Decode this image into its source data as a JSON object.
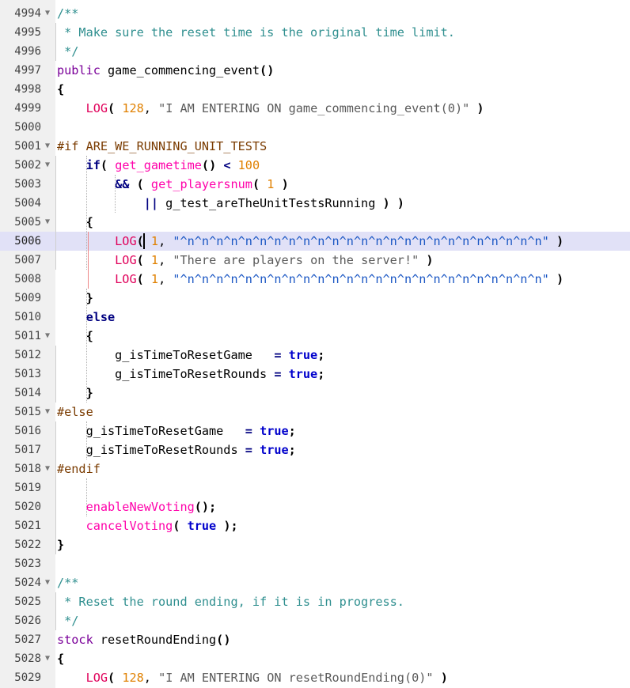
{
  "editor": {
    "current_line": 5006,
    "lines": [
      {
        "num": "4994",
        "fold": "▼",
        "tokens": [
          {
            "t": "/**",
            "c": "t-comment"
          }
        ]
      },
      {
        "num": "4995",
        "fold": "",
        "tokens": [
          {
            "t": " * Make sure the reset time is the original time limit.",
            "c": "t-comment"
          }
        ]
      },
      {
        "num": "4996",
        "fold": "",
        "tokens": [
          {
            "t": " */",
            "c": "t-comment"
          }
        ]
      },
      {
        "num": "4997",
        "fold": "",
        "tokens": [
          {
            "t": "public",
            "c": "t-kw"
          },
          {
            "t": " game_commencing_event",
            "c": "t-ident"
          },
          {
            "t": "()",
            "c": "t-paren"
          }
        ]
      },
      {
        "num": "4998",
        "fold": "",
        "tokens": [
          {
            "t": "{",
            "c": "t-paren"
          }
        ]
      },
      {
        "num": "4999",
        "fold": "",
        "tokens": [
          {
            "t": "    ",
            "c": "t-ident"
          },
          {
            "t": "LOG",
            "c": "t-log"
          },
          {
            "t": "(",
            "c": "t-paren"
          },
          {
            "t": " ",
            "c": "t-ident"
          },
          {
            "t": "128",
            "c": "t-num"
          },
          {
            "t": ", ",
            "c": "t-punct"
          },
          {
            "t": "\"I AM ENTERING ON game_commencing_event(0)\"",
            "c": "t-str"
          },
          {
            "t": " ",
            "c": "t-ident"
          },
          {
            "t": ")",
            "c": "t-paren"
          }
        ]
      },
      {
        "num": "5000",
        "fold": "",
        "tokens": []
      },
      {
        "num": "5001",
        "fold": "▼",
        "tokens": [
          {
            "t": "#if ARE_WE_RUNNING_UNIT_TESTS",
            "c": "t-pre"
          }
        ]
      },
      {
        "num": "5002",
        "fold": "▼",
        "tokens": [
          {
            "t": "    ",
            "c": "t-ident"
          },
          {
            "t": "if",
            "c": "t-op"
          },
          {
            "t": "(",
            "c": "t-paren"
          },
          {
            "t": " ",
            "c": "t-ident"
          },
          {
            "t": "get_gametime",
            "c": "t-func"
          },
          {
            "t": "()",
            "c": "t-paren"
          },
          {
            "t": " < ",
            "c": "t-op"
          },
          {
            "t": "100",
            "c": "t-num"
          }
        ]
      },
      {
        "num": "5003",
        "fold": "",
        "tokens": [
          {
            "t": "        ",
            "c": "t-ident"
          },
          {
            "t": "&&",
            "c": "t-op"
          },
          {
            "t": " ",
            "c": "t-ident"
          },
          {
            "t": "(",
            "c": "t-paren"
          },
          {
            "t": " ",
            "c": "t-ident"
          },
          {
            "t": "get_playersnum",
            "c": "t-func"
          },
          {
            "t": "(",
            "c": "t-paren"
          },
          {
            "t": " ",
            "c": "t-ident"
          },
          {
            "t": "1",
            "c": "t-num"
          },
          {
            "t": " ",
            "c": "t-ident"
          },
          {
            "t": ")",
            "c": "t-paren"
          }
        ]
      },
      {
        "num": "5004",
        "fold": "",
        "tokens": [
          {
            "t": "            ",
            "c": "t-ident"
          },
          {
            "t": "||",
            "c": "t-op"
          },
          {
            "t": " g_test_areTheUnitTestsRunning ",
            "c": "t-ident"
          },
          {
            "t": ")",
            "c": "t-paren"
          },
          {
            "t": " ",
            "c": "t-ident"
          },
          {
            "t": ")",
            "c": "t-paren"
          }
        ]
      },
      {
        "num": "5005",
        "fold": "▼",
        "tokens": [
          {
            "t": "    ",
            "c": "t-ident"
          },
          {
            "t": "{",
            "c": "t-paren"
          }
        ]
      },
      {
        "num": "5006",
        "fold": "",
        "tokens": [
          {
            "t": "        ",
            "c": "t-ident"
          },
          {
            "t": "LOG",
            "c": "t-log"
          },
          {
            "t": "(",
            "c": "t-paren"
          },
          {
            "t": " ",
            "c": "t-ident"
          },
          {
            "t": "1",
            "c": "t-num"
          },
          {
            "t": ", ",
            "c": "t-punct"
          },
          {
            "t": "\"^n^n^n^n^n^n^n^n^n^n^n^n^n^n^n^n^n^n^n^n^n^n^n^n^n\"",
            "c": "t-str-blue"
          },
          {
            "t": " ",
            "c": "t-ident"
          },
          {
            "t": ")",
            "c": "t-paren"
          }
        ]
      },
      {
        "num": "5007",
        "fold": "",
        "tokens": [
          {
            "t": "        ",
            "c": "t-ident"
          },
          {
            "t": "LOG",
            "c": "t-log"
          },
          {
            "t": "(",
            "c": "t-paren"
          },
          {
            "t": " ",
            "c": "t-ident"
          },
          {
            "t": "1",
            "c": "t-num"
          },
          {
            "t": ", ",
            "c": "t-punct"
          },
          {
            "t": "\"There are players on the server!\"",
            "c": "t-str"
          },
          {
            "t": " ",
            "c": "t-ident"
          },
          {
            "t": ")",
            "c": "t-paren"
          }
        ]
      },
      {
        "num": "5008",
        "fold": "",
        "tokens": [
          {
            "t": "        ",
            "c": "t-ident"
          },
          {
            "t": "LOG",
            "c": "t-log"
          },
          {
            "t": "(",
            "c": "t-paren"
          },
          {
            "t": " ",
            "c": "t-ident"
          },
          {
            "t": "1",
            "c": "t-num"
          },
          {
            "t": ", ",
            "c": "t-punct"
          },
          {
            "t": "\"^n^n^n^n^n^n^n^n^n^n^n^n^n^n^n^n^n^n^n^n^n^n^n^n^n\"",
            "c": "t-str-blue"
          },
          {
            "t": " ",
            "c": "t-ident"
          },
          {
            "t": ")",
            "c": "t-paren"
          }
        ]
      },
      {
        "num": "5009",
        "fold": "",
        "tokens": [
          {
            "t": "    ",
            "c": "t-ident"
          },
          {
            "t": "}",
            "c": "t-paren"
          }
        ]
      },
      {
        "num": "5010",
        "fold": "",
        "tokens": [
          {
            "t": "    ",
            "c": "t-ident"
          },
          {
            "t": "else",
            "c": "t-op"
          }
        ]
      },
      {
        "num": "5011",
        "fold": "▼",
        "tokens": [
          {
            "t": "    ",
            "c": "t-ident"
          },
          {
            "t": "{",
            "c": "t-paren"
          }
        ]
      },
      {
        "num": "5012",
        "fold": "",
        "tokens": [
          {
            "t": "        g_isTimeToResetGame   ",
            "c": "t-ident"
          },
          {
            "t": "=",
            "c": "t-op"
          },
          {
            "t": " ",
            "c": "t-ident"
          },
          {
            "t": "true",
            "c": "t-bool"
          },
          {
            "t": ";",
            "c": "t-paren"
          }
        ]
      },
      {
        "num": "5013",
        "fold": "",
        "tokens": [
          {
            "t": "        g_isTimeToResetRounds ",
            "c": "t-ident"
          },
          {
            "t": "=",
            "c": "t-op"
          },
          {
            "t": " ",
            "c": "t-ident"
          },
          {
            "t": "true",
            "c": "t-bool"
          },
          {
            "t": ";",
            "c": "t-paren"
          }
        ]
      },
      {
        "num": "5014",
        "fold": "",
        "tokens": [
          {
            "t": "    ",
            "c": "t-ident"
          },
          {
            "t": "}",
            "c": "t-paren"
          }
        ]
      },
      {
        "num": "5015",
        "fold": "▼",
        "tokens": [
          {
            "t": "#else",
            "c": "t-pre"
          }
        ]
      },
      {
        "num": "5016",
        "fold": "",
        "tokens": [
          {
            "t": "    g_isTimeToResetGame   ",
            "c": "t-ident"
          },
          {
            "t": "=",
            "c": "t-op"
          },
          {
            "t": " ",
            "c": "t-ident"
          },
          {
            "t": "true",
            "c": "t-bool"
          },
          {
            "t": ";",
            "c": "t-paren"
          }
        ]
      },
      {
        "num": "5017",
        "fold": "",
        "tokens": [
          {
            "t": "    g_isTimeToResetRounds ",
            "c": "t-ident"
          },
          {
            "t": "=",
            "c": "t-op"
          },
          {
            "t": " ",
            "c": "t-ident"
          },
          {
            "t": "true",
            "c": "t-bool"
          },
          {
            "t": ";",
            "c": "t-paren"
          }
        ]
      },
      {
        "num": "5018",
        "fold": "▼",
        "tokens": [
          {
            "t": "#endif",
            "c": "t-pre"
          }
        ]
      },
      {
        "num": "5019",
        "fold": "",
        "tokens": []
      },
      {
        "num": "5020",
        "fold": "",
        "tokens": [
          {
            "t": "    ",
            "c": "t-ident"
          },
          {
            "t": "enableNewVoting",
            "c": "t-func"
          },
          {
            "t": "();",
            "c": "t-paren"
          }
        ]
      },
      {
        "num": "5021",
        "fold": "",
        "tokens": [
          {
            "t": "    ",
            "c": "t-ident"
          },
          {
            "t": "cancelVoting",
            "c": "t-func"
          },
          {
            "t": "(",
            "c": "t-paren"
          },
          {
            "t": " ",
            "c": "t-ident"
          },
          {
            "t": "true",
            "c": "t-bool"
          },
          {
            "t": " ",
            "c": "t-ident"
          },
          {
            "t": ");",
            "c": "t-paren"
          }
        ]
      },
      {
        "num": "5022",
        "fold": "",
        "tokens": [
          {
            "t": "}",
            "c": "t-paren"
          }
        ]
      },
      {
        "num": "5023",
        "fold": "",
        "tokens": []
      },
      {
        "num": "5024",
        "fold": "▼",
        "tokens": [
          {
            "t": "/**",
            "c": "t-comment"
          }
        ]
      },
      {
        "num": "5025",
        "fold": "",
        "tokens": [
          {
            "t": " * Reset the round ending, if it is in progress.",
            "c": "t-comment"
          }
        ]
      },
      {
        "num": "5026",
        "fold": "",
        "tokens": [
          {
            "t": " */",
            "c": "t-comment"
          }
        ]
      },
      {
        "num": "5027",
        "fold": "",
        "tokens": [
          {
            "t": "stock",
            "c": "t-kw"
          },
          {
            "t": " resetRoundEnding",
            "c": "t-ident"
          },
          {
            "t": "()",
            "c": "t-paren"
          }
        ]
      },
      {
        "num": "5028",
        "fold": "▼",
        "tokens": [
          {
            "t": "{",
            "c": "t-paren"
          }
        ]
      },
      {
        "num": "5029",
        "fold": "",
        "tokens": [
          {
            "t": "    ",
            "c": "t-ident"
          },
          {
            "t": "LOG",
            "c": "t-log"
          },
          {
            "t": "(",
            "c": "t-paren"
          },
          {
            "t": " ",
            "c": "t-ident"
          },
          {
            "t": "128",
            "c": "t-num"
          },
          {
            "t": ", ",
            "c": "t-punct"
          },
          {
            "t": "\"I AM ENTERING ON resetRoundEnding(0)\"",
            "c": "t-str"
          },
          {
            "t": " ",
            "c": "t-ident"
          },
          {
            "t": ")",
            "c": "t-paren"
          }
        ]
      }
    ]
  },
  "colors": {
    "gutter_bg": "#f0f0f0",
    "current_line_bg": "#e1e1f7",
    "comment": "#2f8f8f",
    "keyword": "#7a0099",
    "function": "#ff00aa",
    "number": "#e08000",
    "string": "#5a5a5a",
    "string_highlight": "#1b57c4",
    "preprocessor": "#7a3b00",
    "boolean": "#0000cc"
  }
}
